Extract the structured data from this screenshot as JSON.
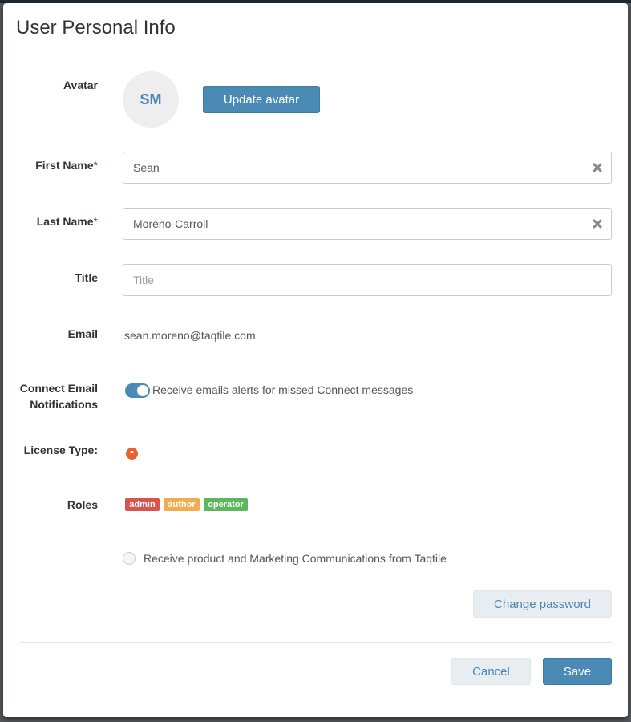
{
  "dialog": {
    "title": "User Personal Info"
  },
  "avatar": {
    "label": "Avatar",
    "initials": "SM",
    "update_button": "Update avatar"
  },
  "first_name": {
    "label": "First Name",
    "required_mark": "*",
    "value": "Sean"
  },
  "last_name": {
    "label": "Last Name",
    "required_mark": "*",
    "value": "Moreno-Carroll"
  },
  "title_field": {
    "label": "Title",
    "placeholder": "Title",
    "value": ""
  },
  "email": {
    "label": "Email",
    "value": "sean.moreno@taqtile.com"
  },
  "notifications": {
    "label_line1": "Connect Email",
    "label_line2": "Notifications",
    "toggle_on": true,
    "toggle_text": "Receive emails alerts for missed Connect messages"
  },
  "license": {
    "label": "License Type:",
    "badge": "F",
    "badge_color": "#e8632b"
  },
  "roles": {
    "label": "Roles",
    "items": [
      {
        "name": "admin",
        "color": "#d9534f"
      },
      {
        "name": "author",
        "color": "#f0ad4e"
      },
      {
        "name": "operator",
        "color": "#5cb85c"
      }
    ]
  },
  "marketing": {
    "checked": false,
    "text": "Receive product and Marketing Communications from Taqtile"
  },
  "buttons": {
    "change_password": "Change password",
    "cancel": "Cancel",
    "save": "Save"
  },
  "colors": {
    "primary": "#4a8ab5",
    "light_button": "#e7edf1",
    "required": "#c9302c"
  }
}
